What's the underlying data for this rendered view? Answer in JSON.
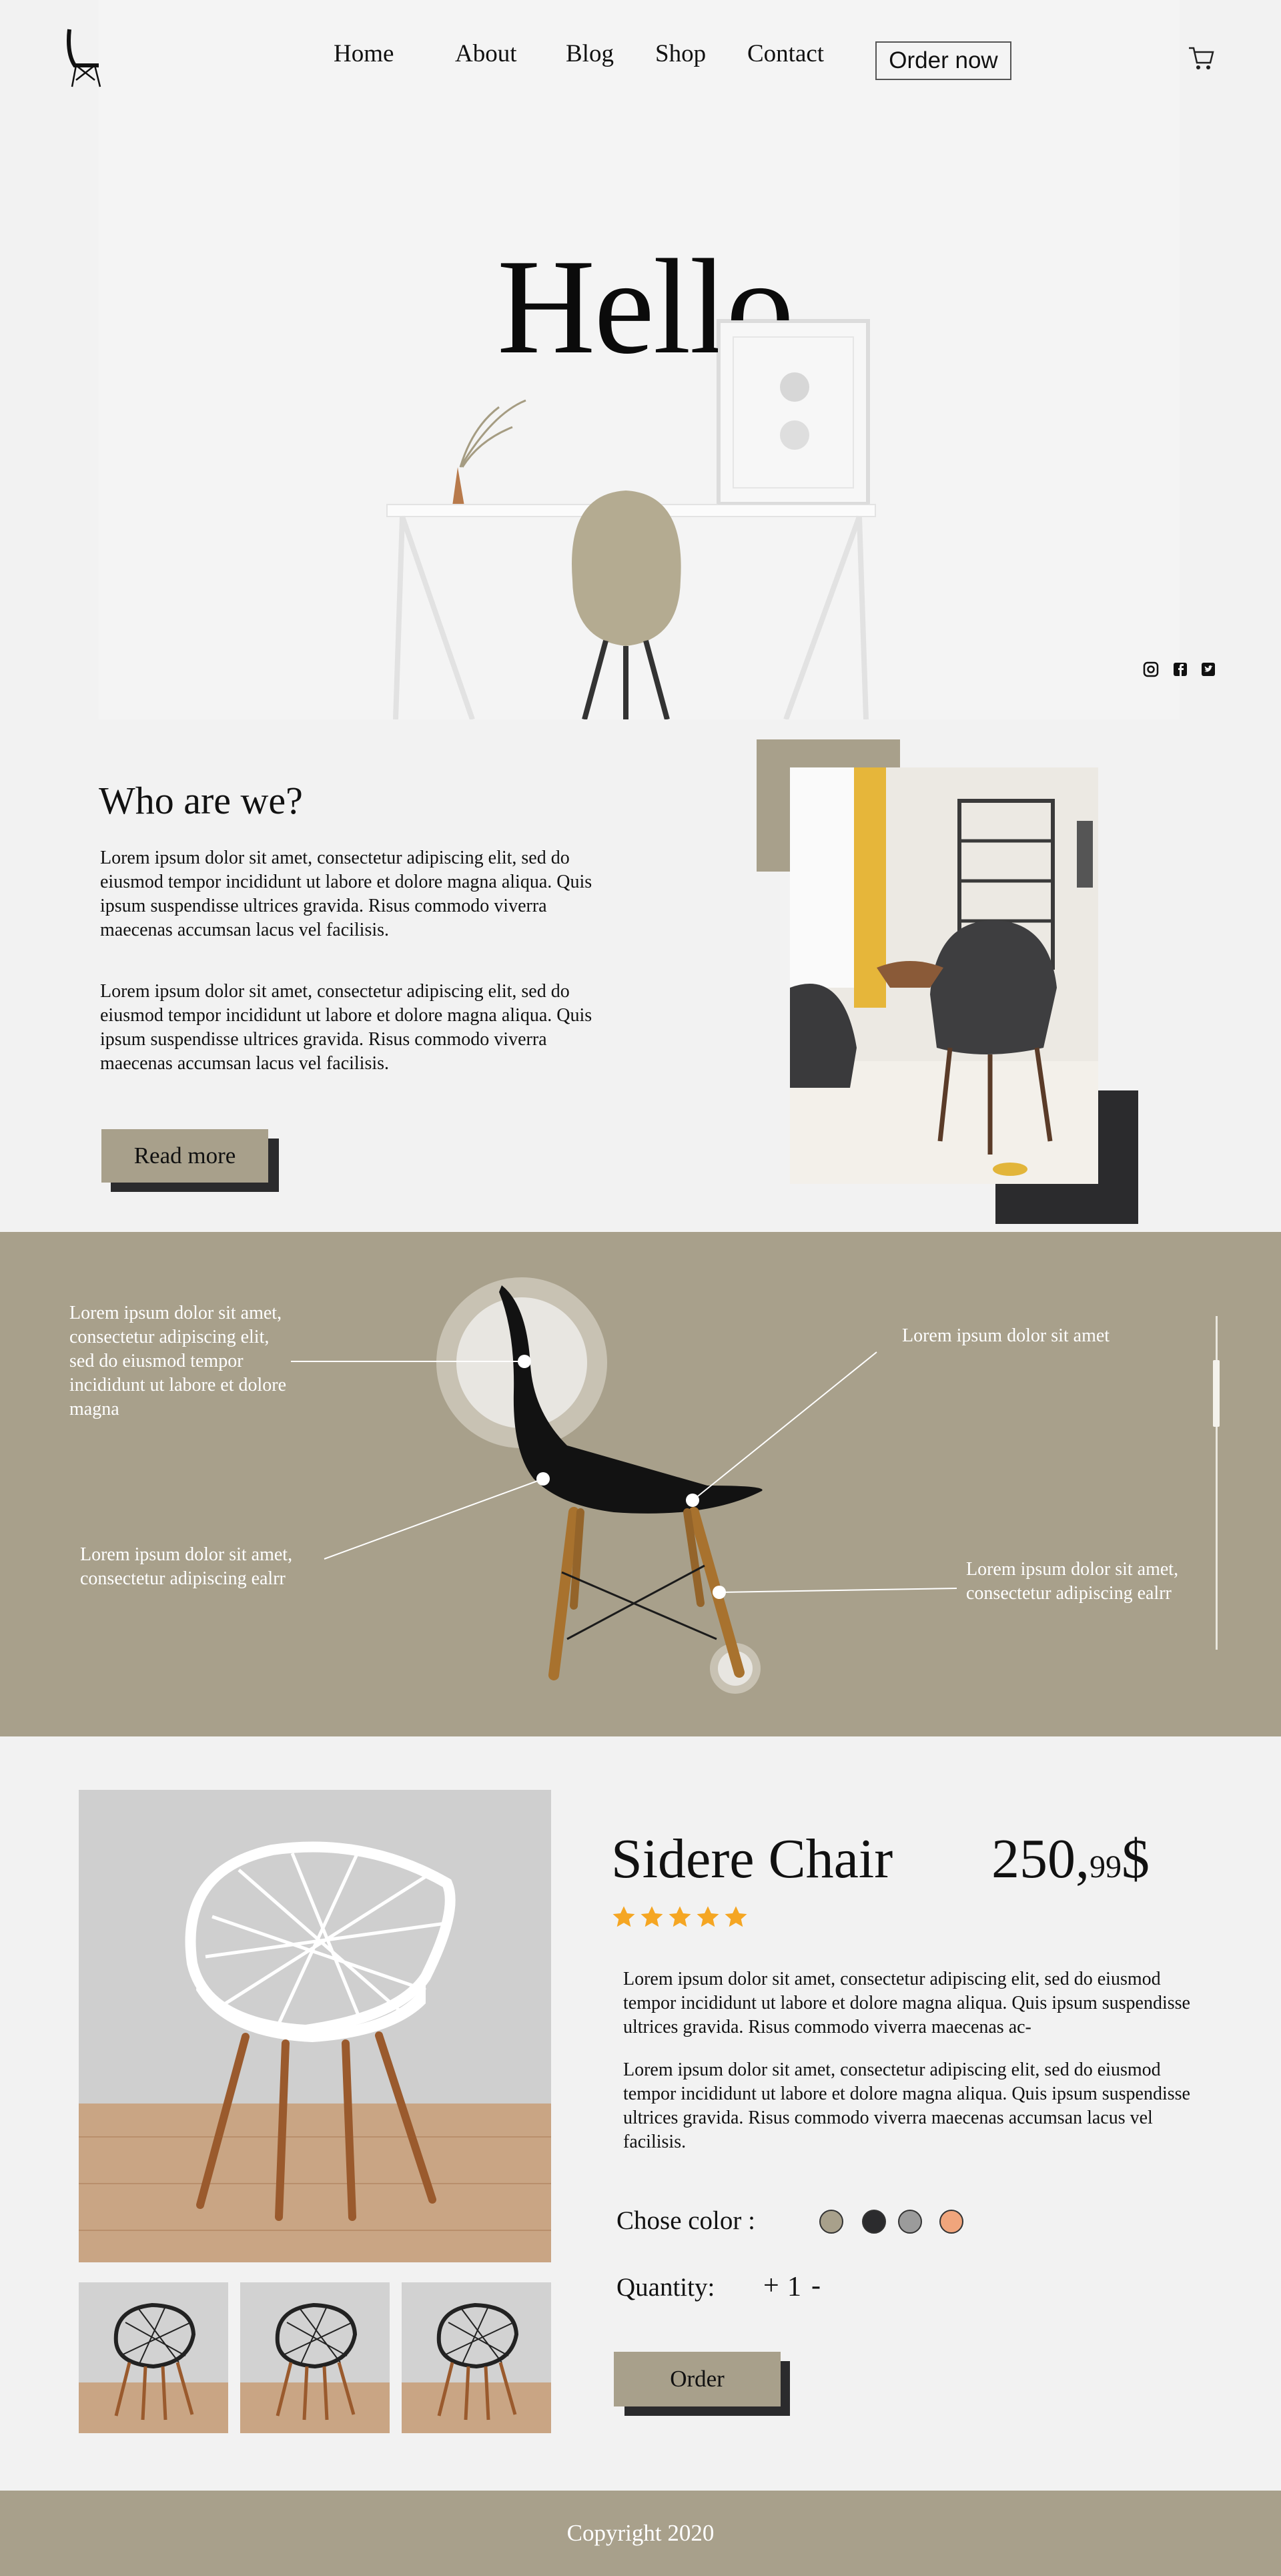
{
  "nav": {
    "logo": "chair-logo-icon",
    "links": [
      "Home",
      "About",
      "Blog",
      "Shop",
      "Contact"
    ],
    "order_now": "Order now",
    "cart_icon": "cart-icon"
  },
  "hero": {
    "headline": "Hello",
    "social_icons": [
      "instagram-icon",
      "facebook-icon",
      "twitter-icon"
    ]
  },
  "about": {
    "title": "Who are we?",
    "paragraphs": [
      "Lorem ipsum dolor sit amet, consectetur adipiscing elit, sed do eiusmod tempor incididunt ut labore et dolore magna aliqua. Quis ipsum suspendisse ultrices gravida. Risus commodo viverra maecenas accumsan lacus vel facilisis.",
      "Lorem ipsum dolor sit amet, consectetur adipiscing elit, sed do eiusmod tempor incididunt ut labore et dolore magna aliqua. Quis ipsum suspendisse ultrices gravida. Risus commodo viverra maecenas accumsan lacus vel facilisis."
    ],
    "read_more": "Read more"
  },
  "features": {
    "callouts": [
      "Lorem ipsum dolor sit amet, consectetur adipiscing elit, sed do eiusmod tempor incididunt ut labore et dolore magna",
      "Lorem ipsum dolor sit amet",
      "Lorem ipsum dolor sit amet, consectetur adipiscing ealrr",
      "Lorem ipsum dolor sit amet, consectetur adipiscing ealrr"
    ]
  },
  "product": {
    "name": "Sidere Chair",
    "price_main": "250,",
    "price_cents": "99",
    "currency": "$",
    "rating": 5,
    "rating_max": 5,
    "star_color": "#f5a623",
    "paragraphs": [
      "Lorem ipsum dolor sit amet, consectetur adipiscing elit, sed do eiusmod tempor incididunt ut labore et dolore magna aliqua. Quis ipsum suspendisse ultrices gravida. Risus commodo viverra maecenas ac-",
      "Lorem ipsum dolor sit amet, consectetur adipiscing elit, sed do eiusmod tempor incididunt ut labore et dolore magna aliqua. Quis ipsum suspendisse ultrices gravida. Risus commodo viverra maecenas accumsan lacus vel facilisis."
    ],
    "color_label": "Chose color :",
    "colors": [
      "#a8a08b",
      "#2b2b2d",
      "#9b9b9b",
      "#f0a57c"
    ],
    "quantity_label": "Quantity:",
    "qty_plus": "+",
    "quantity": "1",
    "qty_minus": "-",
    "order_button": "Order"
  },
  "footer": {
    "copyright": "Copyright 2020"
  },
  "theme": {
    "accent": "#a8a08b",
    "dark": "#2b2b2d",
    "background": "#f2f2f2"
  }
}
